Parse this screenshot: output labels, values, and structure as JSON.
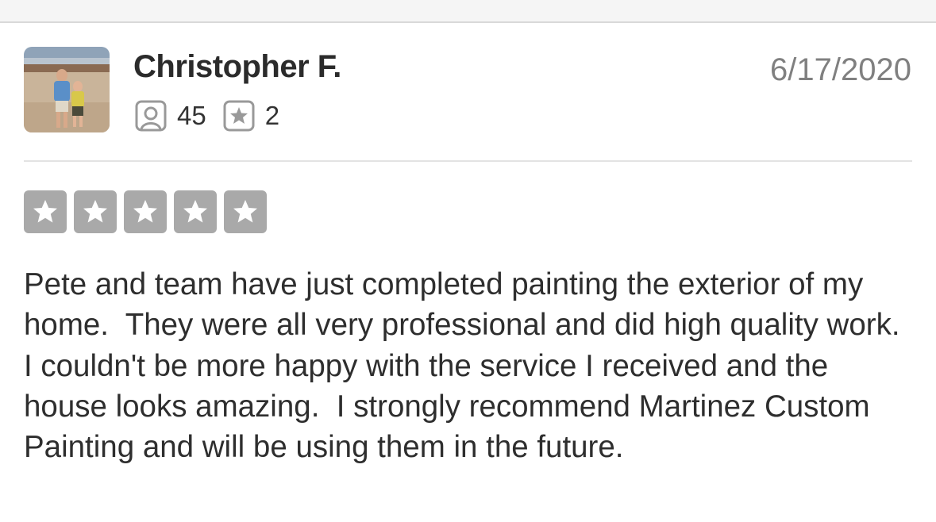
{
  "review": {
    "user_name": "Christopher F.",
    "date": "6/17/2020",
    "friends_count": "45",
    "reviews_count": "2",
    "rating": 5,
    "rating_max": 5,
    "text": "Pete and team have just completed painting the exterior of my home.  They were all very professional and did high quality work.  I couldn't be more happy with the service I received and the house looks amazing.  I strongly recommend Martinez Custom Painting and will be using them in the future."
  },
  "icons": {
    "friends": "friends-icon",
    "reviews": "review-star-icon",
    "rating_star": "star-icon"
  },
  "colors": {
    "star_box": "#a9a9a9",
    "date": "#808080",
    "text": "#2e2e2e",
    "icon_gray": "#999999"
  }
}
